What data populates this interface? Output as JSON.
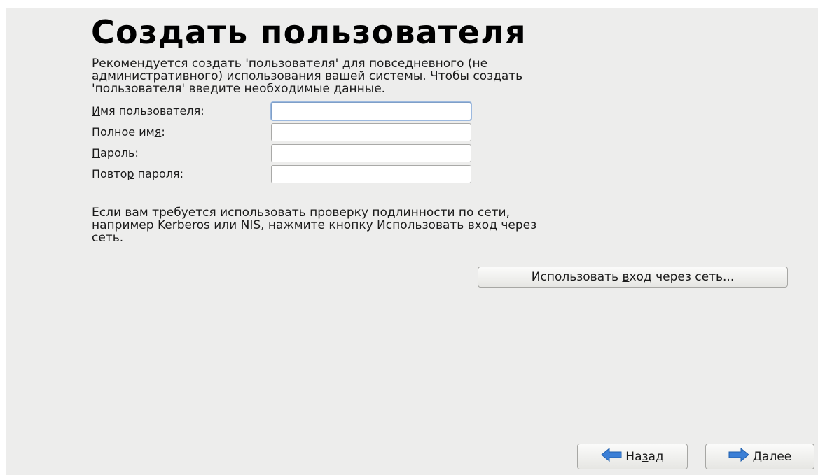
{
  "header": {
    "title": "Создать пользователя"
  },
  "intro": {
    "text": "Рекомендуется создать 'пользователя' для повседневного (не\nадминистративного) использования вашей системы. Чтобы создать\n'пользователя' введите необходимые данные."
  },
  "form": {
    "username": {
      "label_first": "И",
      "label_rest": "мя пользователя:",
      "value": ""
    },
    "fullname": {
      "label_pre": "Полное им",
      "label_u": "я",
      "label_post": ":",
      "value": ""
    },
    "password": {
      "label_first": "П",
      "label_rest": "ароль:",
      "value": ""
    },
    "confirm": {
      "label_pre": "Повто",
      "label_u": "р",
      "label_post": " пароля:",
      "value": ""
    }
  },
  "network": {
    "text": "Если вам требуется использовать проверку подлинности по сети,\nнапример Kerberos или NIS, нажмите кнопку Использовать вход через\nсеть.",
    "button_pre": "Использовать ",
    "button_u": "в",
    "button_post": "ход через сеть..."
  },
  "nav": {
    "back_pre": "На",
    "back_u": "з",
    "back_post": "ад",
    "back_icon": "arrow-left-icon",
    "next_u": "Д",
    "next_post": "алее",
    "next_icon": "arrow-right-icon",
    "arrow_color": "#3b7fd6"
  }
}
